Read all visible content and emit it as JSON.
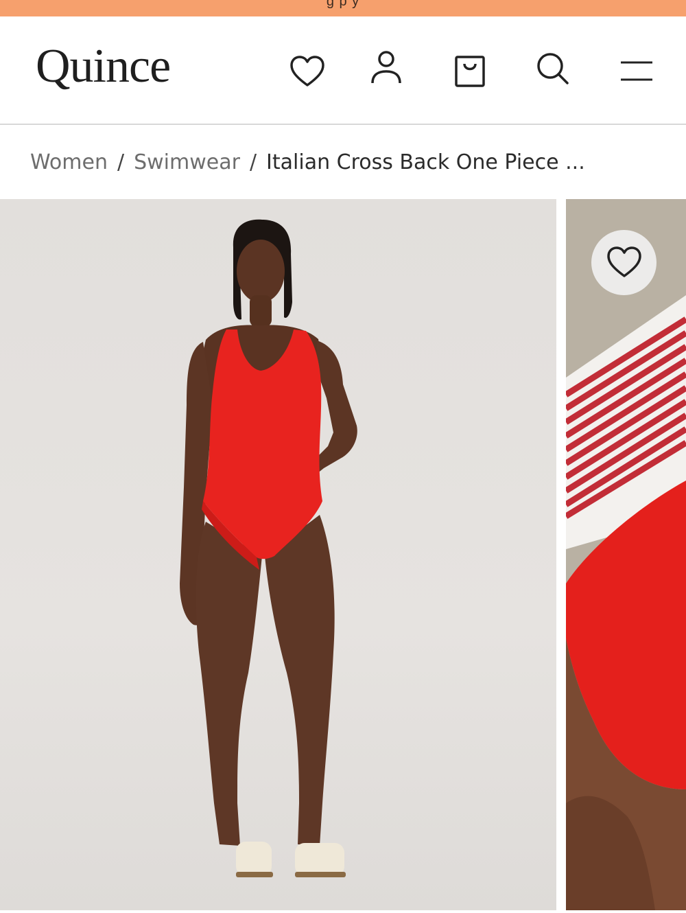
{
  "promo": {
    "text": "g p y "
  },
  "header": {
    "logo_text": "Quince",
    "icons": {
      "wishlist": "heart-icon",
      "account": "user-icon",
      "bag": "shopping-bag-icon",
      "search": "search-icon",
      "menu": "hamburger-menu-icon"
    }
  },
  "breadcrumb": {
    "items": [
      "Women",
      "Swimwear"
    ],
    "separator": "/",
    "current": "Italian Cross Back One Piece ..."
  },
  "gallery": {
    "favorite_icon": "heart-icon"
  },
  "colors": {
    "promo_bg": "#f6a06d",
    "swimsuit_red": "#e8231f",
    "text_dark": "#2b2b2b",
    "text_muted": "#6d6d6d"
  }
}
